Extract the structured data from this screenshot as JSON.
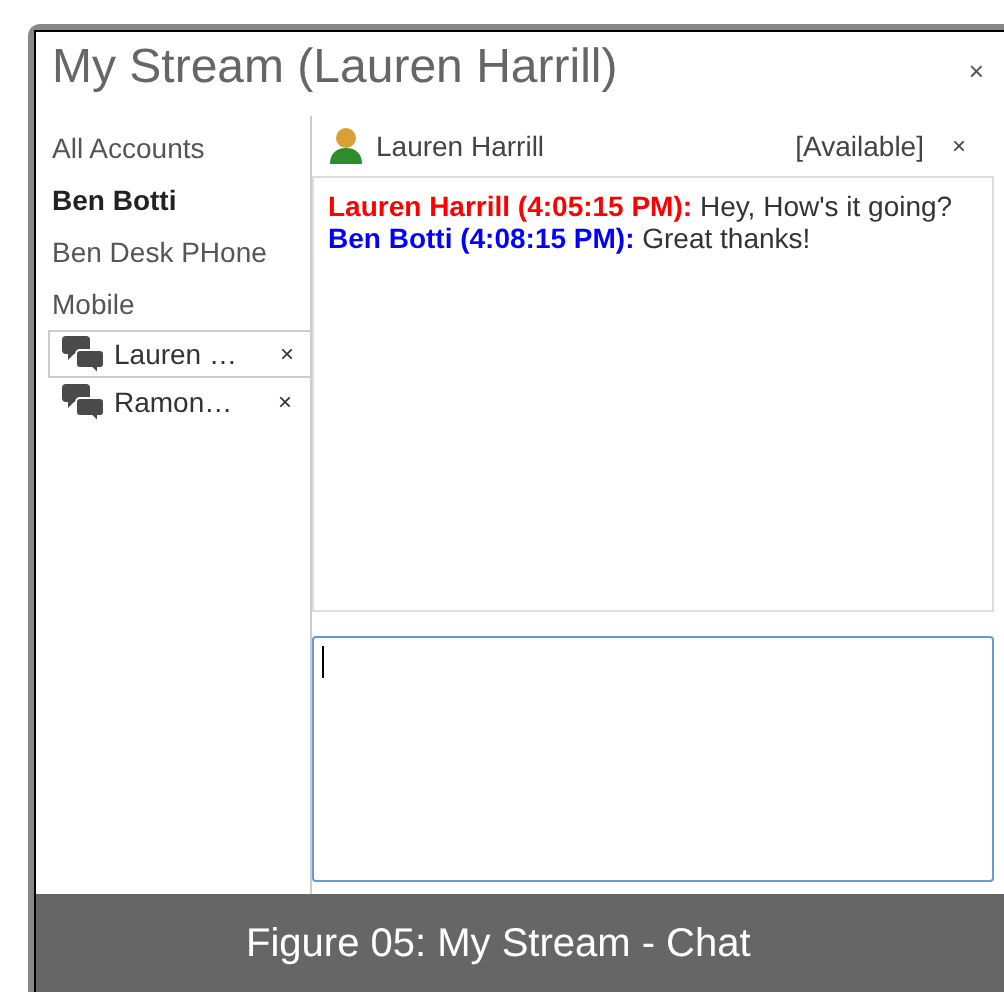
{
  "window": {
    "title": "My Stream (Lauren Harrill)",
    "close": "×"
  },
  "sidebar": {
    "items": [
      {
        "kind": "account",
        "label": "All Accounts",
        "selected": false
      },
      {
        "kind": "account",
        "label": "Ben Botti",
        "selected": true
      },
      {
        "kind": "account",
        "label": "Ben Desk PHone",
        "selected": false
      },
      {
        "kind": "account",
        "label": "Mobile",
        "selected": false
      },
      {
        "kind": "chat",
        "label": "Lauren …",
        "close": "×",
        "selected": true
      },
      {
        "kind": "chat",
        "label": "Ramon…",
        "close": "×",
        "selected": false
      }
    ]
  },
  "chat": {
    "contact": "Lauren Harrill",
    "status": "[Available]",
    "close": "×",
    "messages": [
      {
        "sender": "Lauren Harrill (4:05:15 PM):",
        "text": "Hey, How's it going?",
        "color": "#ff0000"
      },
      {
        "sender": "Ben Botti (4:08:15 PM):",
        "text": "Great thanks!",
        "color": "#0000ff"
      }
    ]
  },
  "caption": "Figure 05: My Stream - Chat"
}
